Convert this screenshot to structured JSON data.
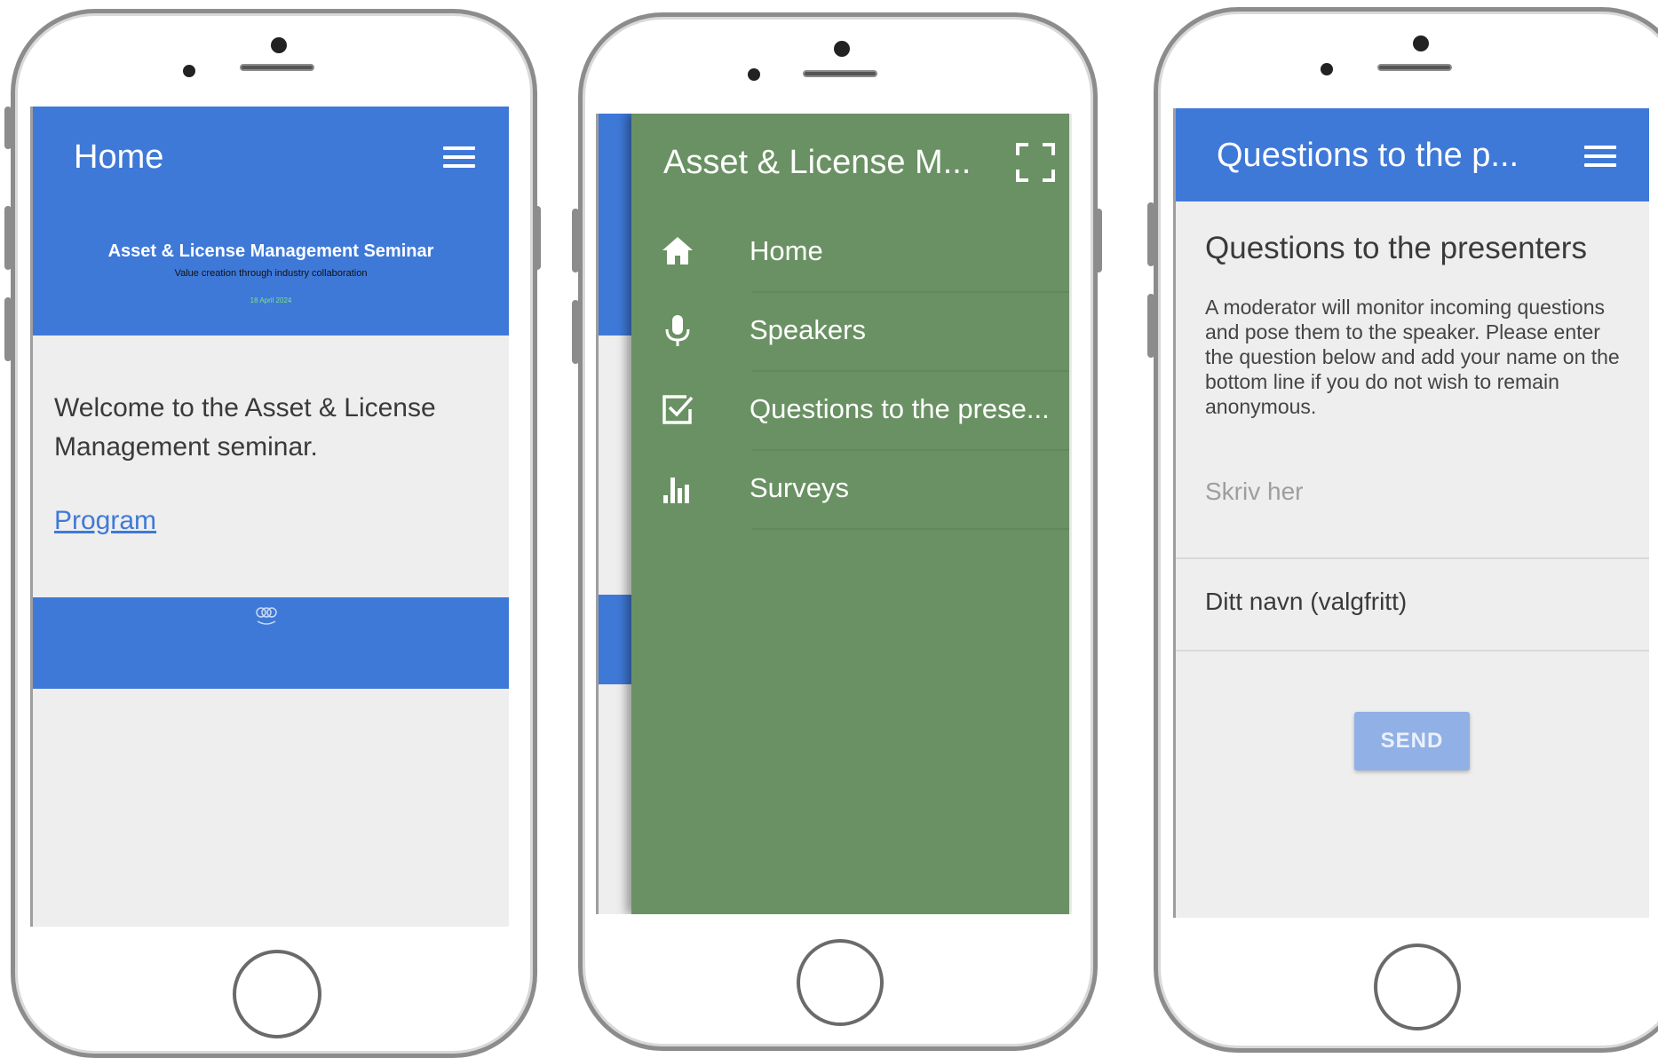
{
  "phone1": {
    "appbar_title": "Home",
    "banner": {
      "title": "Asset & License Management Seminar",
      "subtitle": "Value creation through industry collaboration",
      "date": "18 April 2024"
    },
    "welcome_text": "Welcome to the Asset & License Management seminar.",
    "program_link": "Program"
  },
  "phone2": {
    "drawer_title": "Asset & License M...",
    "menu": [
      {
        "icon": "home-icon",
        "label": "Home"
      },
      {
        "icon": "microphone-icon",
        "label": "Speakers"
      },
      {
        "icon": "checkbox-icon",
        "label": "Questions to the prese..."
      },
      {
        "icon": "bar-chart-icon",
        "label": "Surveys"
      }
    ]
  },
  "phone3": {
    "appbar_title": "Questions to the p...",
    "heading": "Questions to the presenters",
    "description": "A moderator will monitor incoming questions and pose them to the speaker. Please enter the question below and add your name on the bottom line if you do not wish to remain anonymous.",
    "question_placeholder": "Skriv her",
    "name_placeholder": "Ditt navn (valgfritt)",
    "send_label": "SEND"
  },
  "colors": {
    "appbar_blue": "#3f79d8",
    "drawer_green": "#6a9163",
    "screen_bg": "#eeeeee",
    "send_button": "#90b0e6"
  }
}
